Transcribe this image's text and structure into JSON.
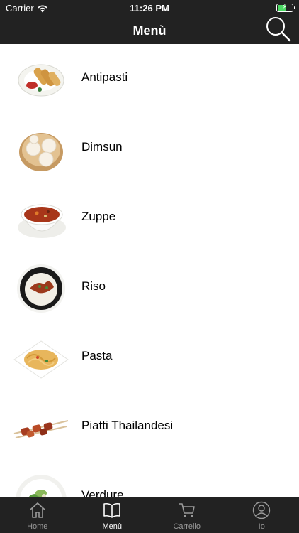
{
  "status_bar": {
    "carrier": "Carrier",
    "time": "11:26 PM",
    "battery_level": 0.55
  },
  "nav": {
    "title": "Menù",
    "search_icon": "search-icon"
  },
  "menu": {
    "items": [
      {
        "label": "Antipasti",
        "icon": "spring-rolls-image"
      },
      {
        "label": "Dimsun",
        "icon": "dumplings-image"
      },
      {
        "label": "Zuppe",
        "icon": "soup-image"
      },
      {
        "label": "Riso",
        "icon": "rice-bowl-image"
      },
      {
        "label": "Pasta",
        "icon": "noodles-image"
      },
      {
        "label": "Piatti Thailandesi",
        "icon": "skewers-image"
      },
      {
        "label": "Verdure",
        "icon": "vegetables-image"
      }
    ]
  },
  "tabbar": {
    "tabs": [
      {
        "label": "Home",
        "icon": "home-icon",
        "active": false
      },
      {
        "label": "Menù",
        "icon": "book-icon",
        "active": true
      },
      {
        "label": "Carrello",
        "icon": "cart-icon",
        "active": false
      },
      {
        "label": "Io",
        "icon": "user-icon",
        "active": false
      }
    ]
  },
  "colors": {
    "header_bg": "#222222",
    "tabbar_bg": "#222222",
    "active_tab": "#ffffff",
    "inactive_tab": "#9a9a9a",
    "battery_fill": "#4cd964"
  }
}
